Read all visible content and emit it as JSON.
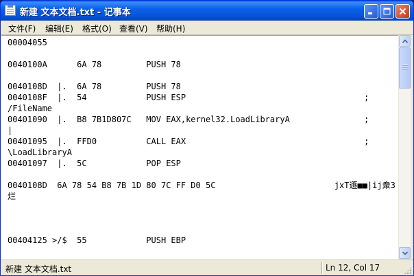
{
  "window": {
    "title": "新建 文本文档.txt - 记事本"
  },
  "menu": [
    {
      "label": "文件(F)"
    },
    {
      "label": "编辑(E)"
    },
    {
      "label": "格式(O)"
    },
    {
      "label": "查看(V)"
    },
    {
      "label": "帮助(H)"
    }
  ],
  "editor": {
    "lines": [
      "00004055",
      "",
      "0040100A      6A 78         PUSH 78",
      "",
      "0040108D  |.  6A 78         PUSH 78",
      "0040108F  |.  54            PUSH ESP                                    ;",
      "/FileName",
      "00401090  |.  B8 7B1D807C   MOV EAX,kernel32.LoadLibraryA               ;",
      "|",
      "00401095  |.  FFD0          CALL EAX                                    ;",
      "\\LoadLibraryA",
      "00401097  |.  5C            POP ESP",
      "",
      "0040108D  6A 78 54 B8 7B 1D 80 7C FF D0 5C                        jxT遯■■|ij衆3",
      "烂",
      "",
      "",
      "",
      "00404125 >/$  55            PUSH EBP"
    ]
  },
  "status": {
    "filename": "新建 文本文档.txt",
    "position": "Ln 12, Col 17"
  },
  "icons": {
    "app": "notepad-icon",
    "minimize": "minimize-icon",
    "maximize": "maximize-icon",
    "close": "close-icon"
  }
}
